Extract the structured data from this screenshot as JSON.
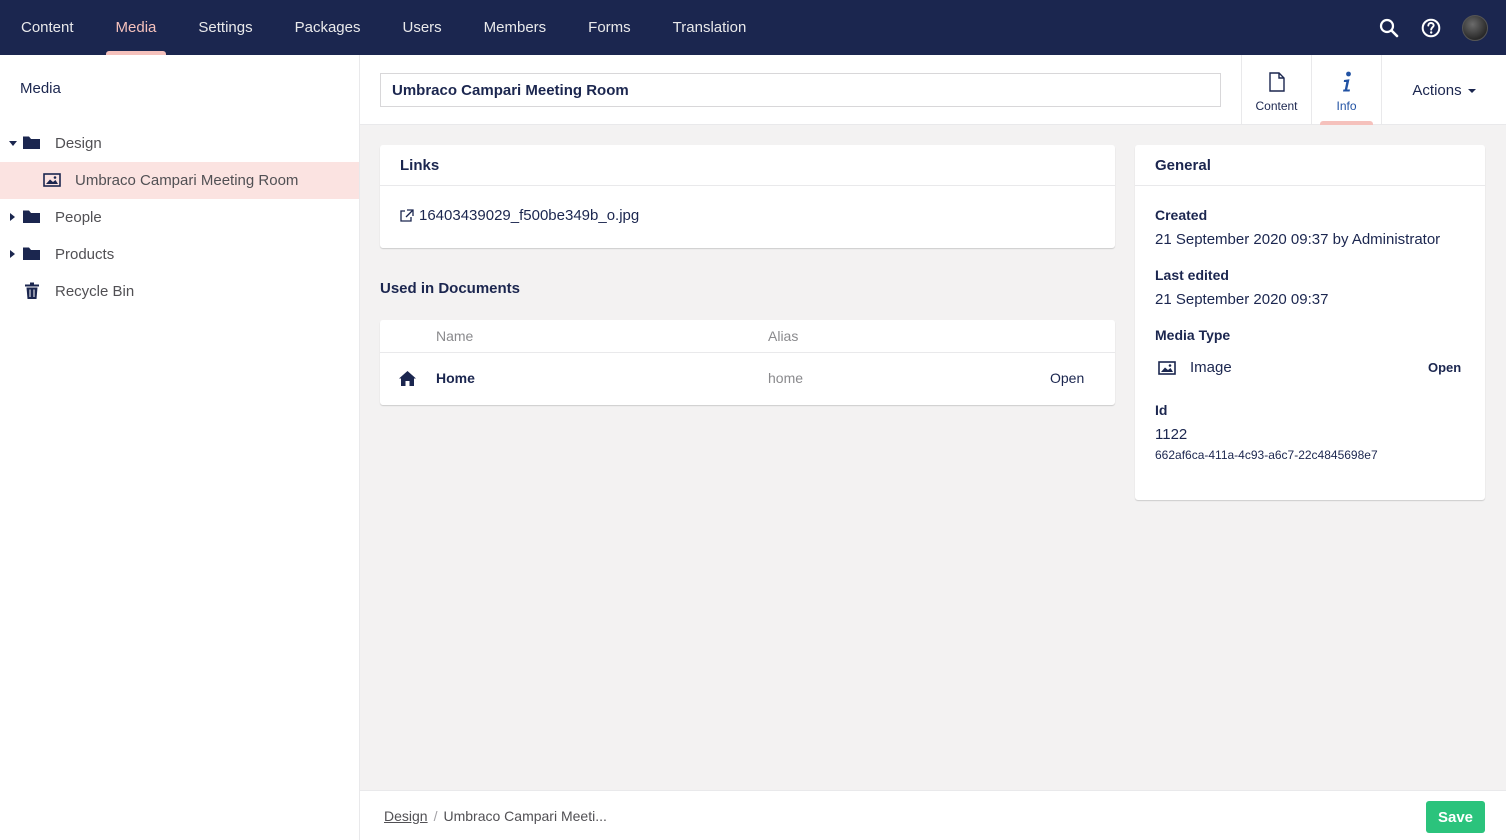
{
  "nav": {
    "items": [
      {
        "label": "Content"
      },
      {
        "label": "Media",
        "active": true
      },
      {
        "label": "Settings"
      },
      {
        "label": "Packages"
      },
      {
        "label": "Users"
      },
      {
        "label": "Members"
      },
      {
        "label": "Forms"
      },
      {
        "label": "Translation"
      }
    ],
    "icons": [
      "search-icon",
      "help-icon",
      "user-avatar"
    ]
  },
  "sidebar": {
    "title": "Media",
    "tree": [
      {
        "label": "Design",
        "icon": "folder-icon",
        "expanded": true
      },
      {
        "label": "Umbraco Campari Meeting Room",
        "icon": "image-icon",
        "selected": true
      },
      {
        "label": "People",
        "icon": "folder-icon",
        "expanded": false
      },
      {
        "label": "Products",
        "icon": "folder-icon",
        "expanded": false
      },
      {
        "label": "Recycle Bin",
        "icon": "trash-icon"
      }
    ]
  },
  "editor": {
    "name_value": "Umbraco Campari Meeting Room",
    "tabs": [
      {
        "label": "Content",
        "icon": "document-icon"
      },
      {
        "label": "Info",
        "icon": "info-icon",
        "active": true
      }
    ],
    "actions_label": "Actions"
  },
  "links": {
    "title": "Links",
    "file": "16403439029_f500be349b_o.jpg"
  },
  "used_in": {
    "title": "Used in Documents",
    "columns": {
      "name": "Name",
      "alias": "Alias"
    },
    "rows": [
      {
        "name": "Home",
        "alias": "home",
        "action": "Open",
        "icon": "home-icon"
      }
    ]
  },
  "general": {
    "title": "General",
    "created_label": "Created",
    "created_value": "21 September 2020 09:37 by Administrator",
    "edited_label": "Last edited",
    "edited_value": "21 September 2020 09:37",
    "type_label": "Media Type",
    "type_value": "Image",
    "type_action": "Open",
    "id_label": "Id",
    "id_value": "1122",
    "guid": "662af6ca-411a-4c93-a6c7-22c4845698e7"
  },
  "footer": {
    "breadcrumb_parent": "Design",
    "breadcrumb_separator": "/",
    "breadcrumb_current": "Umbraco Campari Meeti...",
    "save_label": "Save"
  },
  "colors": {
    "header_bg": "#1b264f",
    "accent_pink": "#f5c1bc",
    "selected_bg": "#fbe3e1",
    "save_green": "#2bc37c"
  }
}
